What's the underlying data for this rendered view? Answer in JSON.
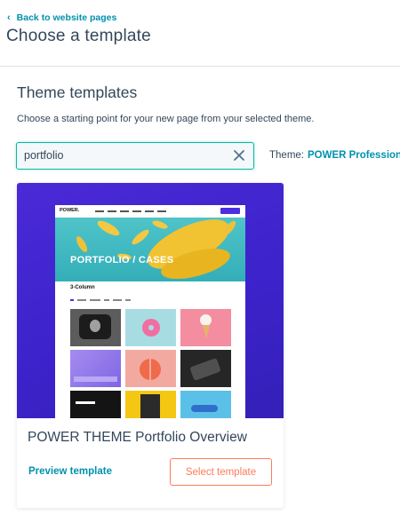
{
  "header": {
    "back_label": "Back to website pages",
    "title": "Choose a template"
  },
  "main": {
    "section_title": "Theme templates",
    "section_description": "Choose a starting point for your new page from your selected theme.",
    "search": {
      "value": "portfolio",
      "placeholder": ""
    },
    "theme_label": "Theme:",
    "theme_value": "POWER Professional"
  },
  "card": {
    "title": "POWER THEME Portfolio Overview",
    "preview_label": "Preview template",
    "select_label": "Select template",
    "thumbnail": {
      "logo": "POWER.",
      "hero_title": "PORTFOLIO / CASES",
      "subtitle": "3-Column"
    }
  },
  "colors": {
    "accent_link": "#0091ae",
    "select_button": "#ff7a59",
    "search_focus": "#00bda5",
    "preview_background": "#4a2ad7",
    "hero_background": "#4fc4c9"
  },
  "icons": {
    "back": "chevron-left-icon",
    "clear": "close-icon"
  }
}
